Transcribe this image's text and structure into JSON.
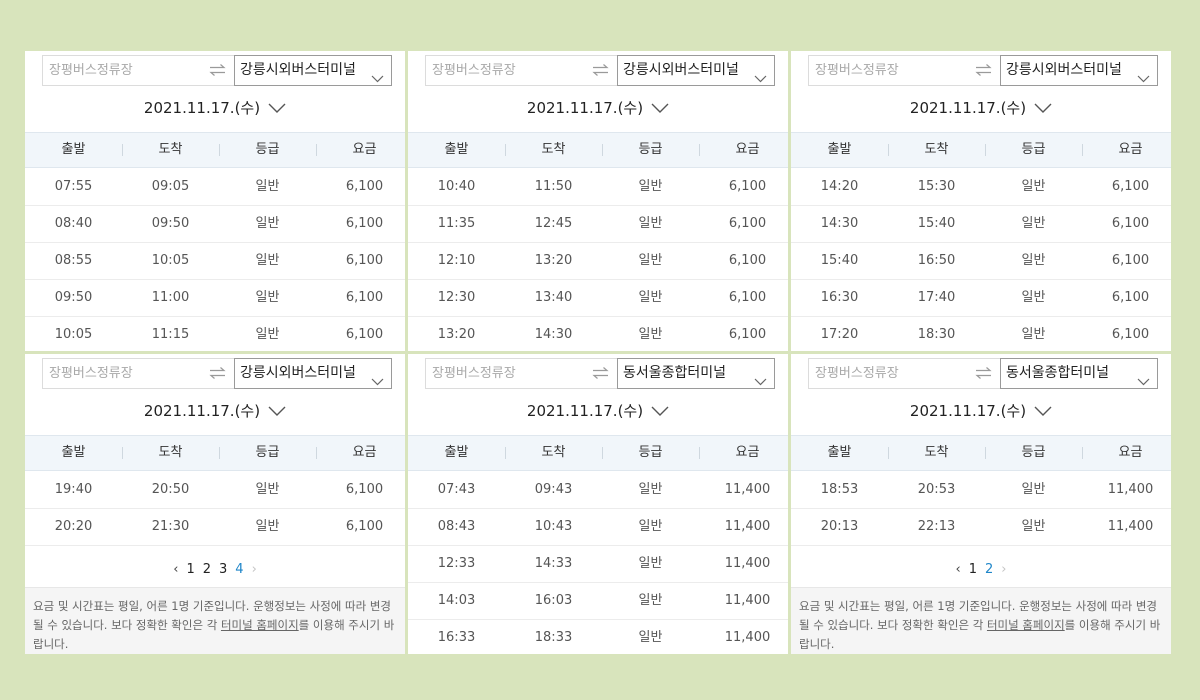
{
  "origin_placeholder": "장평버스정류장",
  "date_label": "2021.11.17.(수)",
  "columns": [
    "출발",
    "도착",
    "등급",
    "요금"
  ],
  "panels": [
    {
      "destination": "강릉시외버스터미널",
      "rows": [
        [
          "07:55",
          "09:05",
          "일반",
          "6,100"
        ],
        [
          "08:40",
          "09:50",
          "일반",
          "6,100"
        ],
        [
          "08:55",
          "10:05",
          "일반",
          "6,100"
        ],
        [
          "09:50",
          "11:00",
          "일반",
          "6,100"
        ],
        [
          "10:05",
          "11:15",
          "일반",
          "6,100"
        ]
      ]
    },
    {
      "destination": "강릉시외버스터미널",
      "rows": [
        [
          "10:40",
          "11:50",
          "일반",
          "6,100"
        ],
        [
          "11:35",
          "12:45",
          "일반",
          "6,100"
        ],
        [
          "12:10",
          "13:20",
          "일반",
          "6,100"
        ],
        [
          "12:30",
          "13:40",
          "일반",
          "6,100"
        ],
        [
          "13:20",
          "14:30",
          "일반",
          "6,100"
        ]
      ]
    },
    {
      "destination": "강릉시외버스터미널",
      "rows": [
        [
          "14:20",
          "15:30",
          "일반",
          "6,100"
        ],
        [
          "14:30",
          "15:40",
          "일반",
          "6,100"
        ],
        [
          "15:40",
          "16:50",
          "일반",
          "6,100"
        ],
        [
          "16:30",
          "17:40",
          "일반",
          "6,100"
        ],
        [
          "17:20",
          "18:30",
          "일반",
          "6,100"
        ]
      ]
    },
    {
      "destination": "강릉시외버스터미널",
      "rows": [
        [
          "19:40",
          "20:50",
          "일반",
          "6,100"
        ],
        [
          "20:20",
          "21:30",
          "일반",
          "6,100"
        ]
      ],
      "pages": [
        "1",
        "2",
        "3",
        "4"
      ],
      "active_page": "4"
    },
    {
      "destination": "동서울종합터미널",
      "rows": [
        [
          "07:43",
          "09:43",
          "일반",
          "11,400"
        ],
        [
          "08:43",
          "10:43",
          "일반",
          "11,400"
        ],
        [
          "12:33",
          "14:33",
          "일반",
          "11,400"
        ],
        [
          "14:03",
          "16:03",
          "일반",
          "11,400"
        ],
        [
          "16:33",
          "18:33",
          "일반",
          "11,400"
        ]
      ]
    },
    {
      "destination": "동서울종합터미널",
      "rows": [
        [
          "18:53",
          "20:53",
          "일반",
          "11,400"
        ],
        [
          "20:13",
          "22:13",
          "일반",
          "11,400"
        ]
      ],
      "pages": [
        "1",
        "2"
      ],
      "active_page": "2"
    }
  ],
  "notice": {
    "before": "요금 및 시간표는 평일, 어른 1명 기준입니다. 운행정보는 사정에 따라 변경될 수 있습니다. 보다 정확한 확인은 각 ",
    "link": "터미널 홈페이지",
    "after": "를 이용해 주시기 바랍니다."
  },
  "icons": {
    "swap": "swap-arrows-icon",
    "dropdown": "chevron-down-icon",
    "prev": "chevron-left-icon",
    "next": "chevron-right-icon"
  },
  "colors": {
    "background": "#d8e4bc",
    "header_bg": "#f1f6fa",
    "active_page": "#1f86c9"
  }
}
